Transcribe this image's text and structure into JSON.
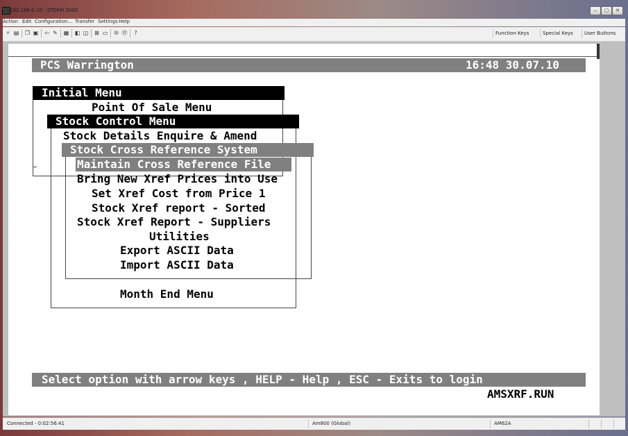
{
  "window": {
    "title": "192.168.0.10 - ZTERM 2000",
    "controls": {
      "minimize": "‒",
      "maximize": "▢",
      "close": "✕"
    }
  },
  "menubar": {
    "items": [
      "Action",
      "Edit",
      "Configuration...",
      "Transfer",
      "Settings",
      "Help"
    ]
  },
  "toolbar": {
    "icons": [
      "connect-icon",
      "print-icon",
      "copy-icon",
      "paste-icon",
      "back-icon",
      "script-icon",
      "properties-icon",
      "record-icon",
      "play-icon",
      "screen-icon",
      "window-icon",
      "font-size-10cpi-icon",
      "font-size-17cpi-icon",
      "help-icon"
    ],
    "function_keys": "Function Keys",
    "special_keys": "Special Keys",
    "user_buttons": "User Buttons"
  },
  "terminal": {
    "header_left": "PCS Warrington",
    "header_right": "16:48 30.07.10",
    "menu1_title": "Initial Menu",
    "menu1_item": "Point Of Sale Menu",
    "menu2_title": "Stock Control Menu",
    "menu2_item1": "Stock Details Enquire & Amend",
    "menu3_title": "Stock Cross Reference System",
    "menu3_items": [
      "Maintain Cross Reference File",
      "Bring New Xref Prices into Use",
      "Set Xref Cost from Price 1",
      "Stock Xref report - Sorted",
      "Stock Xref Report - Suppliers",
      "Utilities",
      "Export ASCII Data",
      "Import ASCII Data"
    ],
    "menu2_item_last": "Month End Menu",
    "footer_prompt": "Select option with arrow keys , HELP - Help , ESC - Exits to login",
    "program_name": "AMSXRF.RUN"
  },
  "statusbar": {
    "connection": "Connected - 0:02:56:41",
    "emulation": "Am800 (Global)",
    "terminal_type": "AM62A"
  },
  "colors": {
    "highlight_gray": "#808080",
    "highlight_black": "#000000",
    "terminal_bg": "#ffffff"
  }
}
